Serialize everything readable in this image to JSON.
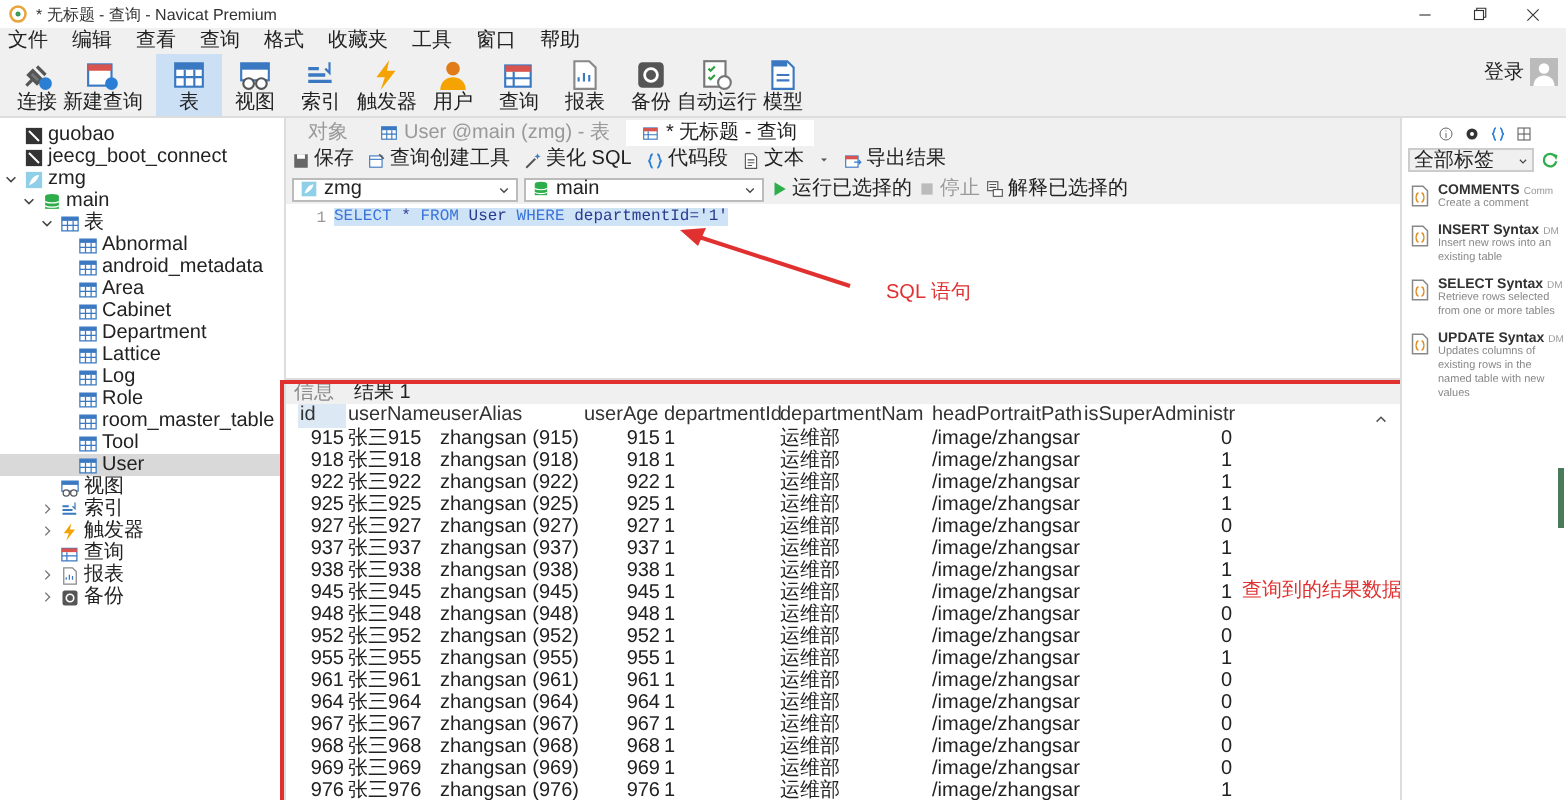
{
  "window": {
    "title": "* 无标题 - 查询 - Navicat Premium"
  },
  "menu": [
    "文件",
    "编辑",
    "查看",
    "查询",
    "格式",
    "收藏夹",
    "工具",
    "窗口",
    "帮助"
  ],
  "toolbar": [
    {
      "label": "连接",
      "kind": "connect",
      "selected": false
    },
    {
      "label": "新建查询",
      "kind": "newquery",
      "selected": false
    },
    {
      "label": "表",
      "kind": "table",
      "selected": true
    },
    {
      "label": "视图",
      "kind": "view",
      "selected": false
    },
    {
      "label": "索引",
      "kind": "index",
      "selected": false
    },
    {
      "label": "触发器",
      "kind": "trigger",
      "selected": false
    },
    {
      "label": "用户",
      "kind": "user",
      "selected": false
    },
    {
      "label": "查询",
      "kind": "query",
      "selected": false
    },
    {
      "label": "报表",
      "kind": "report",
      "selected": false
    },
    {
      "label": "备份",
      "kind": "backup",
      "selected": false
    },
    {
      "label": "自动运行",
      "kind": "autorun",
      "selected": false
    },
    {
      "label": "模型",
      "kind": "model",
      "selected": false
    }
  ],
  "login": "登录",
  "tree": [
    {
      "label": "guobao",
      "kind": "server",
      "selected": false
    },
    {
      "label": "jeecg_boot_connect",
      "kind": "server",
      "selected": false
    },
    {
      "label": "zmg",
      "kind": "connection",
      "selected": false,
      "expanded": true,
      "children": [
        {
          "label": "main",
          "kind": "database",
          "selected": false,
          "expanded": true,
          "children": [
            {
              "label": "表",
              "kind": "table",
              "selected": false,
              "expanded": true,
              "children": [
                {
                  "label": "Abnormal",
                  "kind": "table",
                  "selected": false
                },
                {
                  "label": "android_metadata",
                  "kind": "table",
                  "selected": false
                },
                {
                  "label": "Area",
                  "kind": "table",
                  "selected": false
                },
                {
                  "label": "Cabinet",
                  "kind": "table",
                  "selected": false
                },
                {
                  "label": "Department",
                  "kind": "table",
                  "selected": false
                },
                {
                  "label": "Lattice",
                  "kind": "table",
                  "selected": false
                },
                {
                  "label": "Log",
                  "kind": "table",
                  "selected": false
                },
                {
                  "label": "Role",
                  "kind": "table",
                  "selected": false
                },
                {
                  "label": "room_master_table",
                  "kind": "table",
                  "selected": false
                },
                {
                  "label": "Tool",
                  "kind": "table",
                  "selected": false
                },
                {
                  "label": "User",
                  "kind": "table",
                  "selected": true
                }
              ]
            },
            {
              "label": "视图",
              "kind": "view",
              "selected": false
            },
            {
              "label": "索引",
              "kind": "index",
              "selected": false,
              "expanded": false
            },
            {
              "label": "触发器",
              "kind": "trigger",
              "selected": false,
              "expanded": false
            },
            {
              "label": "查询",
              "kind": "query",
              "selected": false
            },
            {
              "label": "报表",
              "kind": "report",
              "selected": false,
              "expanded": false
            },
            {
              "label": "备份",
              "kind": "backup",
              "selected": false,
              "expanded": false
            }
          ]
        }
      ]
    }
  ],
  "tabs": [
    {
      "label": "对象",
      "kind": "plain",
      "selected": false
    },
    {
      "label": "User @main (zmg) - 表",
      "kind": "table",
      "selected": false
    },
    {
      "label": "* 无标题 - 查询",
      "kind": "query",
      "selected": true
    }
  ],
  "query_toolbar": [
    {
      "label": "保存",
      "kind": "save"
    },
    {
      "label": "查询创建工具",
      "kind": "builder"
    },
    {
      "label": "美化 SQL",
      "kind": "beautify"
    },
    {
      "label": "代码段",
      "kind": "snippet"
    },
    {
      "label": "文本",
      "kind": "text"
    },
    {
      "label": "导出结果",
      "kind": "export"
    }
  ],
  "selectors": [
    {
      "value": "zmg",
      "kind": "connection"
    },
    {
      "value": "main",
      "kind": "database"
    }
  ],
  "run_buttons": [
    {
      "label": "运行已选择的",
      "kind": "run",
      "disabled": false
    },
    {
      "label": "停止",
      "kind": "stop",
      "disabled": true
    },
    {
      "label": "解释已选择的",
      "kind": "explain",
      "disabled": false
    }
  ],
  "editor": {
    "line_number": "1",
    "selected": true,
    "tokens": [
      {
        "text": "SELECT",
        "kind": "keyword"
      },
      {
        "text": "*",
        "kind": "plain"
      },
      {
        "text": "FROM",
        "kind": "keyword"
      },
      {
        "text": "User",
        "kind": "plain"
      },
      {
        "text": "WHERE",
        "kind": "keyword"
      },
      {
        "text": "departmentId=",
        "kind": "plain"
      },
      {
        "text": "'1'",
        "kind": "string"
      }
    ]
  },
  "annotations": [
    {
      "text": "SQL 语句",
      "kind": "sql"
    },
    {
      "text": "查询到的结果数据",
      "kind": "result"
    }
  ],
  "results": {
    "tabs": [
      {
        "label": "信息",
        "selected": false
      },
      {
        "label": "结果 1",
        "selected": true
      }
    ],
    "columns": [
      "id",
      "userName",
      "userAlias",
      "userAge",
      "departmentId",
      "departmentNam",
      "headPortraitPath",
      "isSuperAdministr"
    ],
    "rows": [
      [
        "915",
        "张三915",
        "zhangsan (915)",
        "915",
        "1",
        "运维部",
        "/image/zhangsar",
        "0"
      ],
      [
        "918",
        "张三918",
        "zhangsan (918)",
        "918",
        "1",
        "运维部",
        "/image/zhangsar",
        "1"
      ],
      [
        "922",
        "张三922",
        "zhangsan (922)",
        "922",
        "1",
        "运维部",
        "/image/zhangsar",
        "1"
      ],
      [
        "925",
        "张三925",
        "zhangsan (925)",
        "925",
        "1",
        "运维部",
        "/image/zhangsar",
        "1"
      ],
      [
        "927",
        "张三927",
        "zhangsan (927)",
        "927",
        "1",
        "运维部",
        "/image/zhangsar",
        "0"
      ],
      [
        "937",
        "张三937",
        "zhangsan (937)",
        "937",
        "1",
        "运维部",
        "/image/zhangsar",
        "1"
      ],
      [
        "938",
        "张三938",
        "zhangsan (938)",
        "938",
        "1",
        "运维部",
        "/image/zhangsar",
        "1"
      ],
      [
        "945",
        "张三945",
        "zhangsan (945)",
        "945",
        "1",
        "运维部",
        "/image/zhangsar",
        "1"
      ],
      [
        "948",
        "张三948",
        "zhangsan (948)",
        "948",
        "1",
        "运维部",
        "/image/zhangsar",
        "0"
      ],
      [
        "952",
        "张三952",
        "zhangsan (952)",
        "952",
        "1",
        "运维部",
        "/image/zhangsar",
        "0"
      ],
      [
        "955",
        "张三955",
        "zhangsan (955)",
        "955",
        "1",
        "运维部",
        "/image/zhangsar",
        "1"
      ],
      [
        "961",
        "张三961",
        "zhangsan (961)",
        "961",
        "1",
        "运维部",
        "/image/zhangsar",
        "0"
      ],
      [
        "964",
        "张三964",
        "zhangsan (964)",
        "964",
        "1",
        "运维部",
        "/image/zhangsar",
        "0"
      ],
      [
        "967",
        "张三967",
        "zhangsan (967)",
        "967",
        "1",
        "运维部",
        "/image/zhangsar",
        "0"
      ],
      [
        "968",
        "张三968",
        "zhangsan (968)",
        "968",
        "1",
        "运维部",
        "/image/zhangsar",
        "0"
      ],
      [
        "969",
        "张三969",
        "zhangsan (969)",
        "969",
        "1",
        "运维部",
        "/image/zhangsar",
        "0"
      ],
      [
        "976",
        "张三976",
        "zhangsan (976)",
        "976",
        "1",
        "运维部",
        "/image/zhangsar",
        "1"
      ]
    ]
  },
  "snippets": {
    "filter": "全部标签",
    "items": [
      {
        "title": "COMMENTS",
        "tag": "Comm",
        "description": "Create a comment"
      },
      {
        "title": "INSERT Syntax",
        "tag": "DM",
        "description": "Insert new rows into an existing table"
      },
      {
        "title": "SELECT Syntax",
        "tag": "DM",
        "description": "Retrieve rows selected from one or more tables"
      },
      {
        "title": "UPDATE Syntax",
        "tag": "DM",
        "description": "Updates columns of existing rows in the named table with new values"
      }
    ]
  }
}
